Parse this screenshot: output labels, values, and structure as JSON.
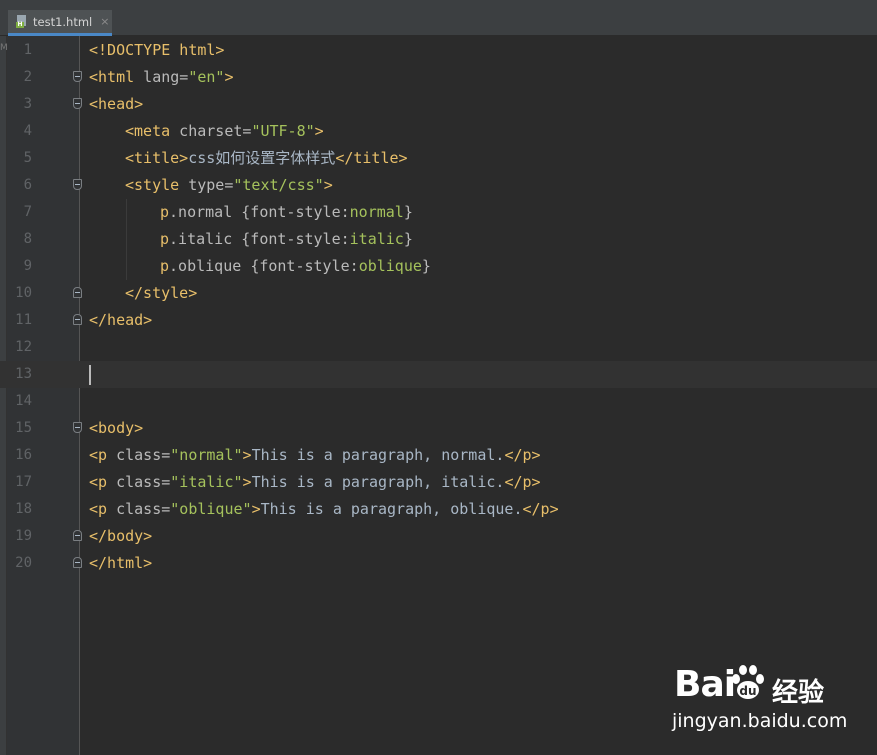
{
  "tab": {
    "filename": "test1.html",
    "close": "×",
    "icon": "html-file-icon",
    "badge": "H"
  },
  "left_strip": {
    "glyph": "M"
  },
  "editor": {
    "current_line": 13,
    "lines": [
      {
        "n": "1"
      },
      {
        "n": "2"
      },
      {
        "n": "3"
      },
      {
        "n": "4"
      },
      {
        "n": "5"
      },
      {
        "n": "6"
      },
      {
        "n": "7"
      },
      {
        "n": "8"
      },
      {
        "n": "9"
      },
      {
        "n": "10"
      },
      {
        "n": "11"
      },
      {
        "n": "12"
      },
      {
        "n": "13"
      },
      {
        "n": "14"
      },
      {
        "n": "15"
      },
      {
        "n": "16"
      },
      {
        "n": "17"
      },
      {
        "n": "18"
      },
      {
        "n": "19"
      },
      {
        "n": "20"
      }
    ],
    "code": {
      "l1_doctype": "<!DOCTYPE html>",
      "l2_open": "<html",
      "l2_attr": " lang=",
      "l2_val": "\"en\"",
      "l2_close": ">",
      "l3": "<head>",
      "l4_open": "<meta",
      "l4_attr": " charset=",
      "l4_val": "\"UTF-8\"",
      "l4_close": ">",
      "l5_open": "<title>",
      "l5_text": "css如何设置字体样式",
      "l5_close": "</title>",
      "l6_open": "<style",
      "l6_attr": " type=",
      "l6_val": "\"text/css\"",
      "l6_close": ">",
      "l7_sel": "p",
      "l7_cls": ".normal ",
      "l7_rule": "{font-style:",
      "l7_val": "normal",
      "l7_end": "}",
      "l8_sel": "p",
      "l8_cls": ".italic ",
      "l8_rule": "{font-style:",
      "l8_val": "italic",
      "l8_end": "}",
      "l9_sel": "p",
      "l9_cls": ".oblique ",
      "l9_rule": "{font-style:",
      "l9_val": "oblique",
      "l9_end": "}",
      "l10": "</style>",
      "l11": "</head>",
      "l15": "<body>",
      "l16_open": "<p",
      "l16_attr": " class=",
      "l16_val": "\"normal\"",
      "l16_gt": ">",
      "l16_text": "This is a paragraph, normal.",
      "l16_close": "</p>",
      "l17_open": "<p",
      "l17_attr": " class=",
      "l17_val": "\"italic\"",
      "l17_gt": ">",
      "l17_text": "This is a paragraph, italic.",
      "l17_close": "</p>",
      "l18_open": "<p",
      "l18_attr": " class=",
      "l18_val": "\"oblique\"",
      "l18_gt": ">",
      "l18_text": "This is a paragraph, oblique.",
      "l18_close": "</p>",
      "l19": "</body>",
      "l20": "</html>"
    }
  },
  "colors": {
    "background": "#2b2b2b",
    "gutter": "#313335",
    "tag": "#e8bf6a",
    "attribute": "#bababa",
    "string": "#a5c25c",
    "text": "#a9b7c6",
    "line_number": "#606366",
    "tab_underline": "#4a88c7"
  },
  "watermark": {
    "logo": "Bai",
    "logo_end": "du",
    "product": "经验",
    "url": "jingyan.baidu.com",
    "icon": "baidu-paw-icon"
  }
}
